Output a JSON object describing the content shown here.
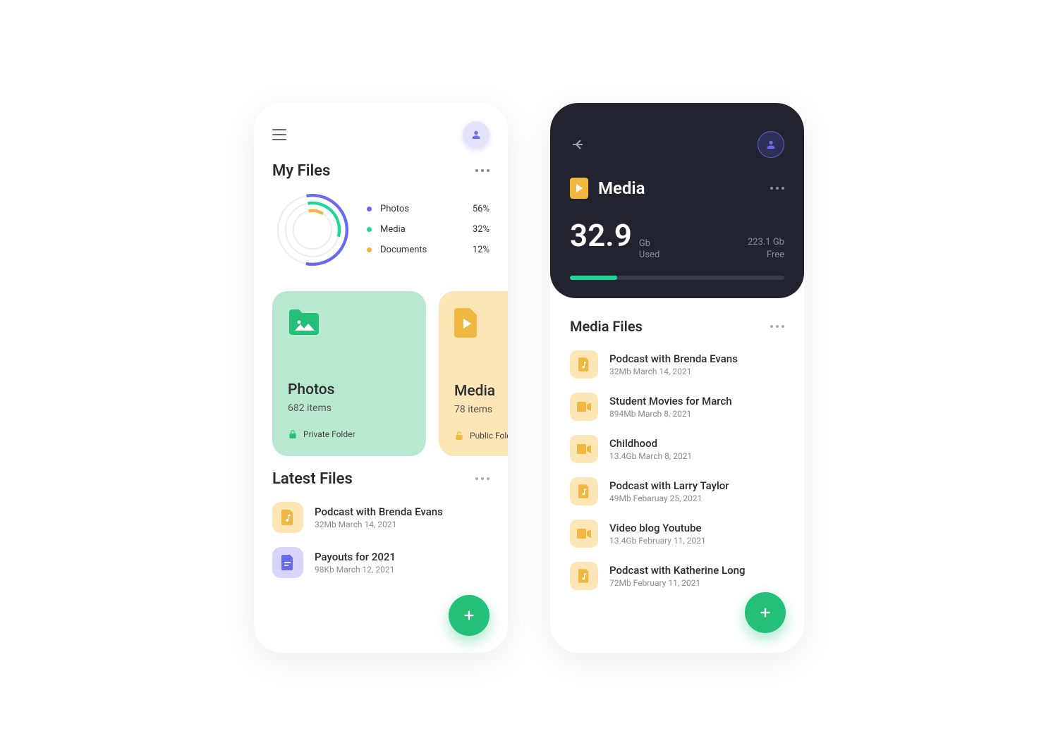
{
  "colors": {
    "green": "#24c07a",
    "teal": "#1ed898",
    "violet": "#6a6af0",
    "amber": "#f0b840",
    "dark": "#21232f"
  },
  "screenA": {
    "title": "My Files",
    "usage": {
      "categories": [
        {
          "name": "Photos",
          "pct": "56%",
          "color": "#6a6af0"
        },
        {
          "name": "Media",
          "pct": "32%",
          "color": "#1ed898"
        },
        {
          "name": "Documents",
          "pct": "12%",
          "color": "#f0b840"
        }
      ]
    },
    "cards": [
      {
        "title": "Photos",
        "sub": "682 items",
        "foot": "Private Folder",
        "iconColor": "#24c07a",
        "lock": "locked"
      },
      {
        "title": "Media",
        "sub": "78 items",
        "foot": "Public Folder",
        "iconColor": "#f0b840",
        "lock": "unlocked"
      }
    ],
    "latestTitle": "Latest Files",
    "latest": [
      {
        "name": "Podcast with Brenda Evans",
        "meta": "32Mb March 14, 2021",
        "icon": "audio",
        "tint": "amber"
      },
      {
        "name": "Payouts for 2021",
        "meta": "98Kb March 12, 2021",
        "icon": "doc",
        "tint": "violet"
      }
    ]
  },
  "screenB": {
    "title": "Media",
    "usedValue": "32.9",
    "usedUnit": "Gb",
    "usedLabel": "Used",
    "freeValue": "223.1 Gb",
    "freeLabel": "Free",
    "progressPct": 22,
    "listTitle": "Media Files",
    "files": [
      {
        "name": "Podcast with Brenda Evans",
        "meta": "32Mb March 14, 2021",
        "icon": "audio"
      },
      {
        "name": "Student Movies for March",
        "meta": "894Mb March 8, 2021",
        "icon": "video"
      },
      {
        "name": "Childhood",
        "meta": "13.4Gb March 8, 2021",
        "icon": "video"
      },
      {
        "name": "Podcast with Larry Taylor",
        "meta": "49Mb Febaruay 25, 2021",
        "icon": "audio"
      },
      {
        "name": "Video blog Youtube",
        "meta": "13.4Gb February 11, 2021",
        "icon": "video"
      },
      {
        "name": "Podcast with Katherine Long",
        "meta": "72Mb February 11, 2021",
        "icon": "audio"
      }
    ]
  }
}
